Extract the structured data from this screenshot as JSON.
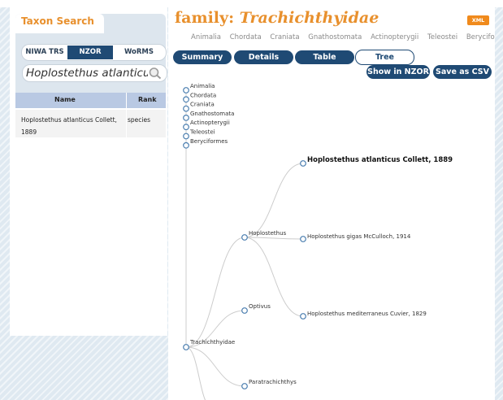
{
  "search": {
    "title": "Taxon Search",
    "sources": [
      {
        "label": "NIWA TRS",
        "active": false
      },
      {
        "label": "NZOR",
        "active": true
      },
      {
        "label": "WoRMS",
        "active": false
      }
    ],
    "query": "Hoplostethus atlanticus",
    "search_icon": "magnifier-icon"
  },
  "results": {
    "columns": [
      "Name",
      "Rank"
    ],
    "rows": [
      {
        "name": "Hoplostethus atlanticus Collett, 1889",
        "rank": "species"
      }
    ]
  },
  "header": {
    "rank": "family:",
    "taxon": "Trachichthyidae",
    "xml_label": "XML",
    "lineage": [
      "Animalia",
      "Chordata",
      "Craniata",
      "Gnathostomata",
      "Actinopterygii",
      "Teleostei",
      "Beryciforme"
    ]
  },
  "tabs": [
    {
      "label": "Summary",
      "active": false
    },
    {
      "label": "Details",
      "active": false
    },
    {
      "label": "Table",
      "active": false
    },
    {
      "label": "Tree",
      "active": true
    }
  ],
  "actions": {
    "nzor": "Show in NZOR",
    "csv": "Save as CSV"
  },
  "tree": {
    "ancestors": [
      "Animalia",
      "Chordata",
      "Craniata",
      "Gnathostomata",
      "Actinopterygii",
      "Teleostei",
      "Beryciformes"
    ],
    "root": "Trachichthyidae",
    "genera": [
      "Hoplostethus",
      "Optivus",
      "Paratrachichthys"
    ],
    "species": [
      "Hoplostethus atlanticus Collett, 1889",
      "Hoplostethus gigas McCulloch, 1914",
      "Hoplostethus mediterraneus Cuvier, 1829"
    ],
    "highlighted_species": "Hoplostethus atlanticus Collett, 1889"
  },
  "colors": {
    "accent_orange": "#e8902d",
    "nav_blue": "#1f4a74",
    "node_stroke": "#4c7fb0",
    "header_row": "#b9c9e3"
  }
}
